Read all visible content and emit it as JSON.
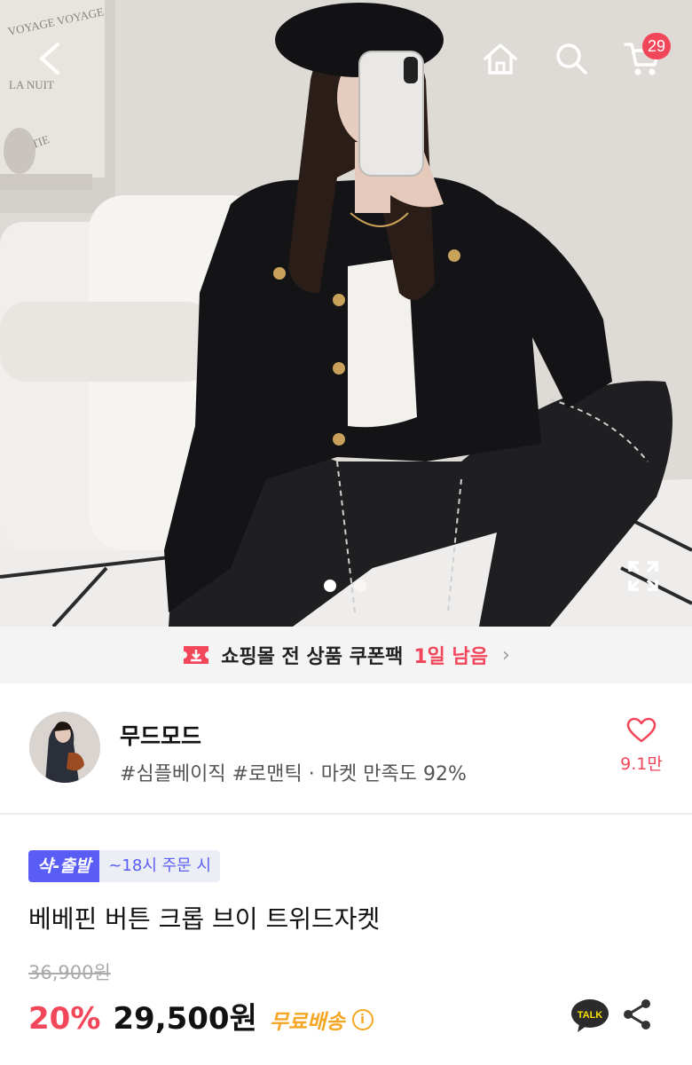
{
  "header": {
    "back_icon": "chevron-left-icon",
    "home_icon": "home-icon",
    "search_icon": "search-icon",
    "cart_icon": "cart-icon",
    "cart_count": "29"
  },
  "hero": {
    "slide_count": 2,
    "active_slide": 1,
    "expand_icon": "expand-icon"
  },
  "coupon": {
    "text": "쇼핑몰 전 상품 쿠폰팩",
    "remaining": "1일 남음",
    "icon": "coupon-download-icon",
    "accent": "#f2465a"
  },
  "shop": {
    "name": "무드모드",
    "meta": "#심플베이직 #로맨틱 · 마켓 만족도 92%",
    "likes": "9.1만",
    "like_icon": "heart-icon"
  },
  "product": {
    "fast_tag": "샥-출발",
    "order_tag": "~18시 주문 시",
    "title": "베베핀 버튼 크롭 브이 트위드자켓",
    "original_price": "36,900원",
    "discount": "20%",
    "price": "29,500원",
    "shipping": "무료배송",
    "talk_label": "TALK"
  },
  "colors": {
    "accent": "#f2465a",
    "fast_tag_bg": "#5a5cf6",
    "shipping": "#f5a623"
  }
}
